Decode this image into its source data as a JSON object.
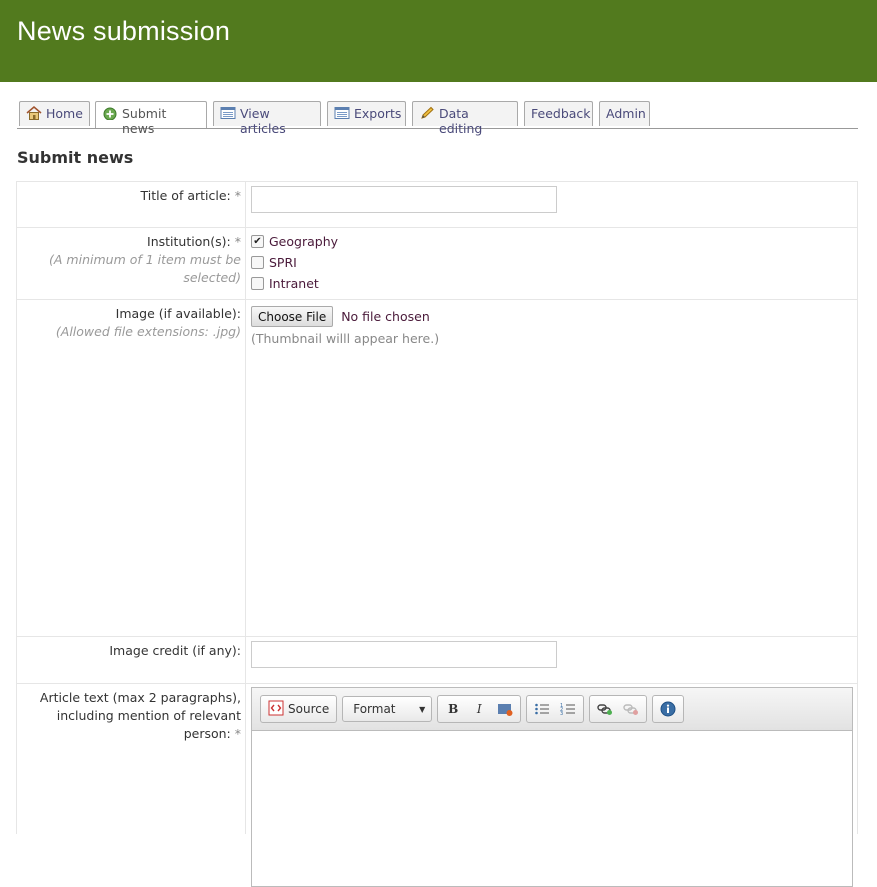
{
  "header": {
    "title": "News submission"
  },
  "tabs": [
    {
      "label": "Home",
      "icon": "home-icon"
    },
    {
      "label": "Submit news",
      "icon": "add-icon"
    },
    {
      "label": "View articles",
      "icon": "list-icon"
    },
    {
      "label": "Exports",
      "icon": "list-icon"
    },
    {
      "label": "Data editing",
      "icon": "pencil-icon"
    },
    {
      "label": "Feedback"
    },
    {
      "label": "Admin"
    }
  ],
  "active_tab": "Submit news",
  "page_title": "Submit news",
  "form": {
    "title": {
      "label": "Title of article:",
      "required": "*",
      "value": ""
    },
    "institution": {
      "label": "Institution(s):",
      "required": "*",
      "hint": "(A minimum of 1 item must be selected)",
      "options": [
        {
          "label": "Geography",
          "checked": true
        },
        {
          "label": "SPRI",
          "checked": false
        },
        {
          "label": "Intranet",
          "checked": false
        }
      ]
    },
    "image": {
      "label": "Image (if available):",
      "hint": "(Allowed file extensions: .jpg)",
      "button": "Choose File",
      "status": "No file chosen",
      "thumbnail_text": "(Thumbnail willl appear here.)"
    },
    "image_credit": {
      "label": "Image credit (if any):",
      "value": ""
    },
    "article_text": {
      "label": "Article text (max 2 paragraphs), including mention of relevant person:",
      "required": "*",
      "toolbar": {
        "source": "Source",
        "format": "Format",
        "bold": "B",
        "italic": "I"
      }
    }
  },
  "colors": {
    "header": "#527a1e",
    "link": "#4a4a7a"
  }
}
